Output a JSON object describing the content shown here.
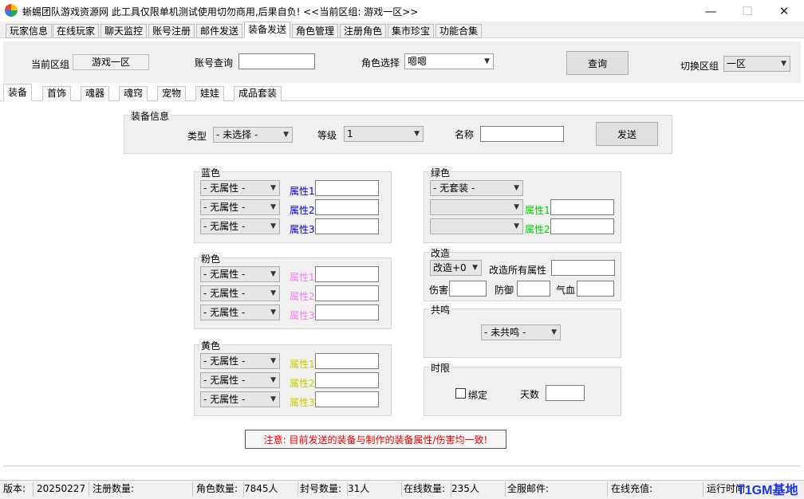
{
  "window": {
    "title": "蜥蜴团队游戏资源网 此工具仅限单机测试使用切勿商用,后果自负! <<当前区组: 游戏一区>>",
    "controls": {
      "minimize": "—",
      "maximize": "☐",
      "close": "✕"
    }
  },
  "menu": [
    "玩家信息",
    "在线玩家",
    "聊天监控",
    "账号注册",
    "邮件发送",
    "装备发送",
    "角色管理",
    "注册角色",
    "集市珍宝",
    "功能合集"
  ],
  "menu_active_index": 5,
  "toolbar": {
    "zone_label": "当前区组",
    "zone_value": "游戏一区",
    "account_label": "账号查询",
    "account_value": "",
    "role_label": "角色选择",
    "role_value": "嗯嗯",
    "query_button": "查询",
    "switch_label": "切换区组",
    "switch_value": "一区"
  },
  "tabs": [
    "装备",
    "首饰",
    "魂器",
    "魂窍",
    "宠物",
    "娃娃",
    "成品套装"
  ],
  "tabs_active_index": 0,
  "equip_info": {
    "title": "装备信息",
    "type_label": "类型",
    "type_value": "- 未选择 -",
    "level_label": "等级",
    "level_value": "1",
    "name_label": "名称",
    "name_value": "",
    "send_button": "发送"
  },
  "blue": {
    "title": "蓝色",
    "attr_select": "- 无属性 -",
    "attr_labels": [
      "属性1",
      "属性2",
      "属性3"
    ],
    "color": "#0000cc"
  },
  "pink": {
    "title": "粉色",
    "attr_select": "- 无属性 -",
    "attr_labels": [
      "属性1",
      "属性2",
      "属性3"
    ],
    "color": "#ee82ee"
  },
  "yellow": {
    "title": "黄色",
    "attr_select": "- 无属性 -",
    "attr_labels": [
      "属性1",
      "属性2",
      "属性3"
    ],
    "color": "#cccc00"
  },
  "green": {
    "title": "绿色",
    "set_select": "- 无套装 -",
    "attr_labels": [
      "属性1",
      "属性2"
    ],
    "color": "#00cc00"
  },
  "modify": {
    "title": "改造",
    "level_select": "改造+0",
    "all_label": "改造所有属性",
    "damage_label": "伤害",
    "defense_label": "防御",
    "hp_label": "气血"
  },
  "resonance": {
    "title": "共鸣",
    "select": "- 未共鸣 -"
  },
  "time_limit": {
    "title": "时限",
    "bind_label": "绑定",
    "days_label": "天数"
  },
  "notice": "注意: 目前发送的装备与制作的装备属性/伤害均一致!",
  "status": {
    "version_label": "版本:",
    "version_value": "20250227",
    "reg_label": "注册数量:",
    "reg_value": "",
    "role_label": "角色数量:",
    "role_value": "7845人",
    "ban_label": "封号数量:",
    "ban_value": "31人",
    "online_label": "在线数量:",
    "online_value": "235人",
    "mail_label": "全服邮件:",
    "mail_value": "",
    "recharge_label": "在线充值:",
    "recharge_value": "",
    "runtime_label": "运行时间",
    "watermark": "T1GM基地"
  },
  "icons": {
    "dropdown": "chevron-down-icon",
    "app": "app-logo-icon"
  }
}
